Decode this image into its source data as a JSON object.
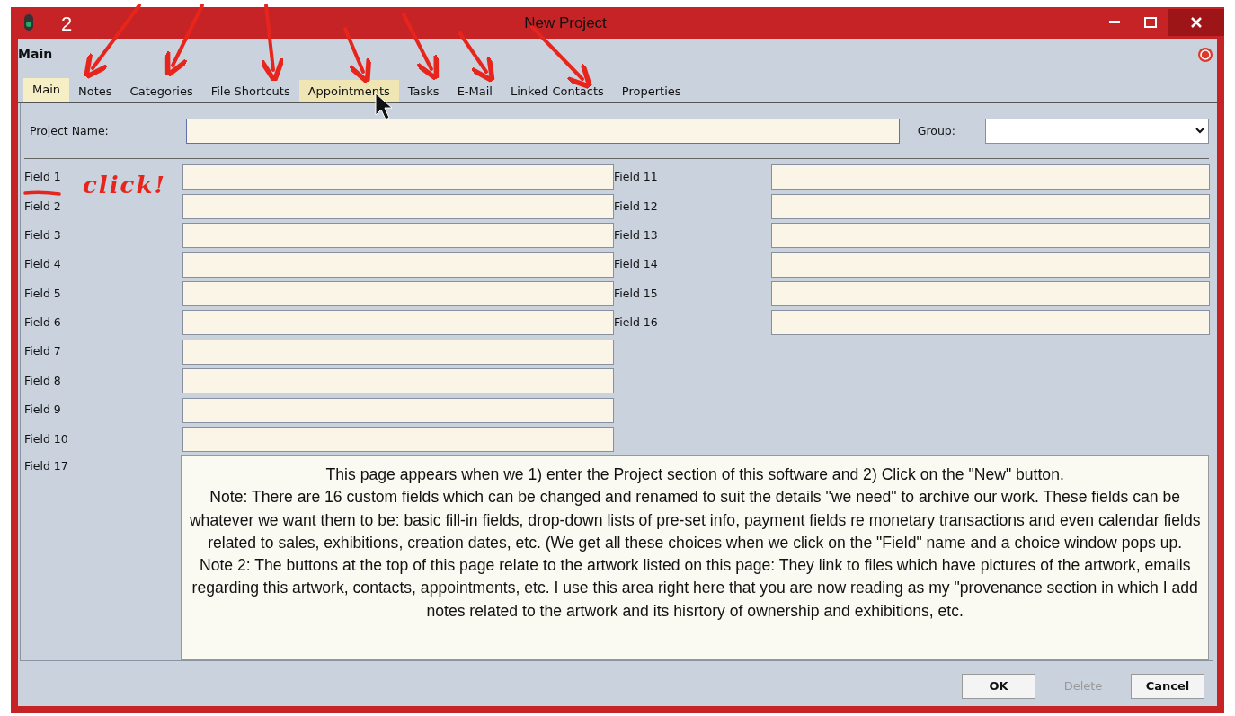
{
  "window": {
    "title": "New Project"
  },
  "annotations": {
    "number": "2",
    "note": "click!"
  },
  "header": "Main",
  "tabs": [
    {
      "label": "Main",
      "selected": true,
      "hovered": false
    },
    {
      "label": "Notes",
      "selected": false,
      "hovered": false
    },
    {
      "label": "Categories",
      "selected": false,
      "hovered": false
    },
    {
      "label": "File Shortcuts",
      "selected": false,
      "hovered": false
    },
    {
      "label": "Appointments",
      "selected": false,
      "hovered": true
    },
    {
      "label": "Tasks",
      "selected": false,
      "hovered": false
    },
    {
      "label": "E-Mail",
      "selected": false,
      "hovered": false
    },
    {
      "label": "Linked Contacts",
      "selected": false,
      "hovered": false
    },
    {
      "label": "Properties",
      "selected": false,
      "hovered": false
    }
  ],
  "project_name": {
    "label": "Project Name:"
  },
  "group": {
    "label": "Group:"
  },
  "fields_left": [
    {
      "label": "Field 1"
    },
    {
      "label": "Field 2"
    },
    {
      "label": "Field 3"
    },
    {
      "label": "Field 4"
    },
    {
      "label": "Field 5"
    },
    {
      "label": "Field 6"
    },
    {
      "label": "Field 7"
    },
    {
      "label": "Field 8"
    },
    {
      "label": "Field 9"
    },
    {
      "label": "Field 10"
    }
  ],
  "fields_right": [
    {
      "label": "Field 11"
    },
    {
      "label": "Field 12"
    },
    {
      "label": "Field 13"
    },
    {
      "label": "Field 14"
    },
    {
      "label": "Field 15"
    },
    {
      "label": "Field 16"
    }
  ],
  "field_17": {
    "label": "Field 17",
    "value": "This page appears when we 1) enter the Project section of this software and 2) Click on the \"New\" button.\nNote: There are 16 custom fields which can be changed and renamed to suit the details \"we need\" to archive our work. These fields can be whatever we want them to be: basic fill-in fields, drop-down lists of pre-set info, payment fields re monetary transactions and even calendar fields related to sales, exhibitions, creation dates, etc. (We get all these choices when we click on the \"Field\" name and a choice window pops up. Note 2: The buttons at the top of this page relate to the artwork listed on this page: They link to files which have pictures of the artwork, emails regarding this artwork, contacts, appointments, etc. I use this area right here that you are now reading as my \"provenance section in which I add notes related to the artwork and its hisrtory of ownership and exhibitions, etc."
  },
  "buttons": [
    {
      "label": "OK",
      "disabled": false
    },
    {
      "label": "Delete",
      "disabled": true
    },
    {
      "label": "Cancel",
      "disabled": false
    }
  ]
}
